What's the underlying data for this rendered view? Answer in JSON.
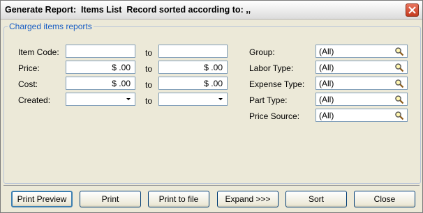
{
  "window": {
    "title": "Generate Report:  Items List  Record sorted according to: ,,"
  },
  "group": {
    "title": "Charged items reports"
  },
  "left": {
    "to_label": "to",
    "rows": [
      {
        "label": "Item Code:",
        "from": "",
        "to": ""
      },
      {
        "label": "Price:",
        "from": "$ .00",
        "to": "$ .00"
      },
      {
        "label": "Cost:",
        "from": "$ .00",
        "to": "$ .00"
      },
      {
        "label": "Created:",
        "from": "",
        "to": ""
      }
    ]
  },
  "right": {
    "rows": [
      {
        "label": "Group:",
        "value": "(All)"
      },
      {
        "label": "Labor Type:",
        "value": "(All)"
      },
      {
        "label": "Expense Type:",
        "value": "(All)"
      },
      {
        "label": "Part Type:",
        "value": "(All)"
      },
      {
        "label": "Price Source:",
        "value": "(All)"
      }
    ]
  },
  "buttons": {
    "print_preview": "Print Preview",
    "print": "Print",
    "print_to_file": "Print to file",
    "expand": "Expand >>>",
    "sort": "Sort",
    "close": "Close"
  },
  "icons": {
    "close": "close-icon",
    "lookup": "magnifier-icon",
    "dropdown": "chevron-down-icon"
  },
  "colors": {
    "window_bg": "#ece9d8",
    "legend_text": "#1b5fc4",
    "close_button": "#c43a1f",
    "field_border": "#7f9db9"
  }
}
